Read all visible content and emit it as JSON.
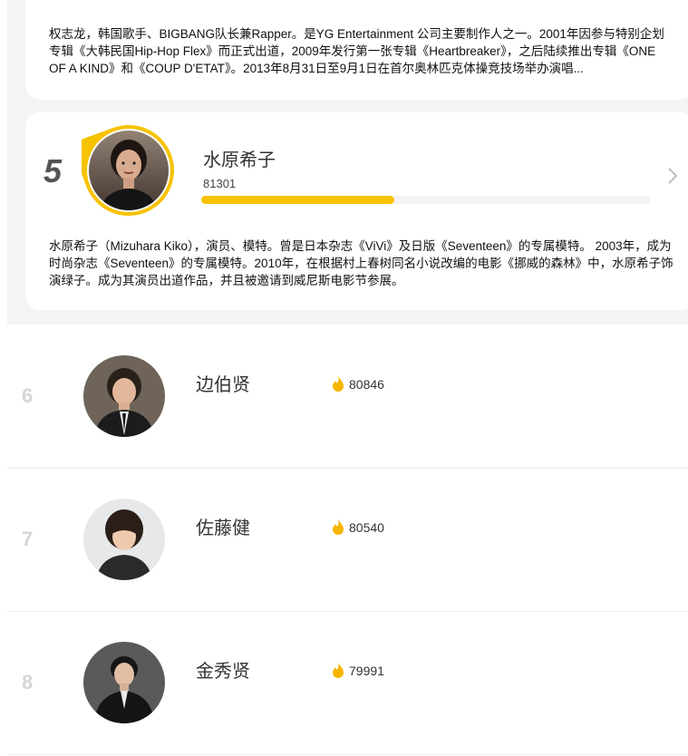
{
  "colors": {
    "accent": "#f7c200",
    "rank_grey": "#d6d6d6",
    "bg_top": "#f4f4f4"
  },
  "prev_card": {
    "description": "权志龙，韩国歌手、BIGBANG队长兼Rapper。是YG Entertainment 公司主要制作人之一。2001年因参与特别企划专辑《大韩民国Hip-Hop Flex》而正式出道，2009年发行第一张专辑《Heartbreaker》，之后陆续推出专辑《ONE OF A KIND》和《COUP D'ETAT》。2013年8月31日至9月1日在首尔奥林匹克体操竞技场举办演唱..."
  },
  "featured": {
    "rank": "5",
    "name": "水原希子",
    "score": "81301",
    "progress_percent": 43,
    "description": "水原希子（Mizuhara Kiko），演员、模特。曾是日本杂志《ViVi》及日版《Seventeen》的专属模特。 2003年，成为时尚杂志《Seventeen》的专属模特。2010年，在根据村上春树同名小说改编的电影《挪威的森林》中，水原希子饰演绿子。成为其演员出道作品，并且被邀请到威尼斯电影节参展。",
    "avatar_icon": "portrait-woman-icon",
    "chevron_icon": "chevron-right-icon"
  },
  "rows": [
    {
      "rank": "6",
      "name": "边伯贤",
      "score": "80846",
      "avatar_icon": "portrait-man-suit-icon"
    },
    {
      "rank": "7",
      "name": "佐藤健",
      "score": "80540",
      "avatar_icon": "portrait-man-icon"
    },
    {
      "rank": "8",
      "name": "金秀贤",
      "score": "79991",
      "avatar_icon": "portrait-man-dark-suit-icon"
    }
  ],
  "score_icon": "flame-icon"
}
